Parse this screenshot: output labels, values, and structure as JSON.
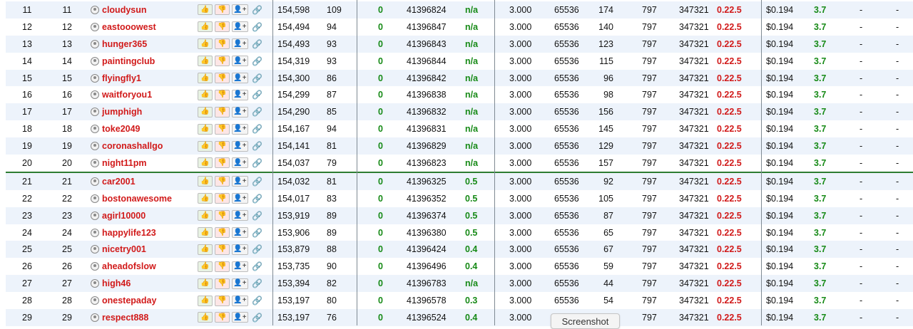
{
  "icons": {
    "upvote": "thumbs-up-icon",
    "downvote": "thumbs-down-icon",
    "follow": "add-user-icon",
    "link": "link-icon",
    "avatar": "user-avatar-icon"
  },
  "glyphs": {
    "up": "👍",
    "down": "👎",
    "add": "👤+",
    "link": "🔗"
  },
  "colors": {
    "username": "#d11a1a",
    "positive": "#178a17",
    "separator": "#2e7d32",
    "stripe": "#edf3fb"
  },
  "rows": [
    {
      "rank": "11",
      "rank2": "11",
      "user": "cloudysun",
      "score": "154,598",
      "n1": "109",
      "zero": "0",
      "id": "41396824",
      "rate": "n/a",
      "f1": "3.000",
      "f2": "65536",
      "f3": "174",
      "f4": "797",
      "f5": "347321",
      "ver": "0.22.5",
      "price": "$0.194",
      "num": "3.7",
      "d1": "-",
      "d2": "-"
    },
    {
      "rank": "12",
      "rank2": "12",
      "user": "eastooowest",
      "score": "154,494",
      "n1": "94",
      "zero": "0",
      "id": "41396847",
      "rate": "n/a",
      "f1": "3.000",
      "f2": "65536",
      "f3": "140",
      "f4": "797",
      "f5": "347321",
      "ver": "0.22.5",
      "price": "$0.194",
      "num": "3.7",
      "d1": "-",
      "d2": "-"
    },
    {
      "rank": "13",
      "rank2": "13",
      "user": "hunger365",
      "score": "154,493",
      "n1": "93",
      "zero": "0",
      "id": "41396843",
      "rate": "n/a",
      "f1": "3.000",
      "f2": "65536",
      "f3": "123",
      "f4": "797",
      "f5": "347321",
      "ver": "0.22.5",
      "price": "$0.194",
      "num": "3.7",
      "d1": "-",
      "d2": "-"
    },
    {
      "rank": "14",
      "rank2": "14",
      "user": "paintingclub",
      "score": "154,319",
      "n1": "93",
      "zero": "0",
      "id": "41396844",
      "rate": "n/a",
      "f1": "3.000",
      "f2": "65536",
      "f3": "115",
      "f4": "797",
      "f5": "347321",
      "ver": "0.22.5",
      "price": "$0.194",
      "num": "3.7",
      "d1": "-",
      "d2": "-"
    },
    {
      "rank": "15",
      "rank2": "15",
      "user": "flyingfly1",
      "score": "154,300",
      "n1": "86",
      "zero": "0",
      "id": "41396842",
      "rate": "n/a",
      "f1": "3.000",
      "f2": "65536",
      "f3": "96",
      "f4": "797",
      "f5": "347321",
      "ver": "0.22.5",
      "price": "$0.194",
      "num": "3.7",
      "d1": "-",
      "d2": "-"
    },
    {
      "rank": "16",
      "rank2": "16",
      "user": "waitforyou1",
      "score": "154,299",
      "n1": "87",
      "zero": "0",
      "id": "41396838",
      "rate": "n/a",
      "f1": "3.000",
      "f2": "65536",
      "f3": "98",
      "f4": "797",
      "f5": "347321",
      "ver": "0.22.5",
      "price": "$0.194",
      "num": "3.7",
      "d1": "-",
      "d2": "-"
    },
    {
      "rank": "17",
      "rank2": "17",
      "user": "jumphigh",
      "score": "154,290",
      "n1": "85",
      "zero": "0",
      "id": "41396832",
      "rate": "n/a",
      "f1": "3.000",
      "f2": "65536",
      "f3": "156",
      "f4": "797",
      "f5": "347321",
      "ver": "0.22.5",
      "price": "$0.194",
      "num": "3.7",
      "d1": "-",
      "d2": "-"
    },
    {
      "rank": "18",
      "rank2": "18",
      "user": "toke2049",
      "score": "154,167",
      "n1": "94",
      "zero": "0",
      "id": "41396831",
      "rate": "n/a",
      "f1": "3.000",
      "f2": "65536",
      "f3": "145",
      "f4": "797",
      "f5": "347321",
      "ver": "0.22.5",
      "price": "$0.194",
      "num": "3.7",
      "d1": "-",
      "d2": "-"
    },
    {
      "rank": "19",
      "rank2": "19",
      "user": "coronashallgo",
      "score": "154,141",
      "n1": "81",
      "zero": "0",
      "id": "41396829",
      "rate": "n/a",
      "f1": "3.000",
      "f2": "65536",
      "f3": "129",
      "f4": "797",
      "f5": "347321",
      "ver": "0.22.5",
      "price": "$0.194",
      "num": "3.7",
      "d1": "-",
      "d2": "-"
    },
    {
      "rank": "20",
      "rank2": "20",
      "user": "night11pm",
      "score": "154,037",
      "n1": "79",
      "zero": "0",
      "id": "41396823",
      "rate": "n/a",
      "f1": "3.000",
      "f2": "65536",
      "f3": "157",
      "f4": "797",
      "f5": "347321",
      "ver": "0.22.5",
      "price": "$0.194",
      "num": "3.7",
      "d1": "-",
      "d2": "-"
    },
    {
      "rank": "21",
      "rank2": "21",
      "user": "car2001",
      "score": "154,032",
      "n1": "81",
      "zero": "0",
      "id": "41396325",
      "rate": "0.5",
      "f1": "3.000",
      "f2": "65536",
      "f3": "92",
      "f4": "797",
      "f5": "347321",
      "ver": "0.22.5",
      "price": "$0.194",
      "num": "3.7",
      "d1": "-",
      "d2": "-",
      "sep": true
    },
    {
      "rank": "22",
      "rank2": "22",
      "user": "bostonawesome",
      "score": "154,017",
      "n1": "83",
      "zero": "0",
      "id": "41396352",
      "rate": "0.5",
      "f1": "3.000",
      "f2": "65536",
      "f3": "105",
      "f4": "797",
      "f5": "347321",
      "ver": "0.22.5",
      "price": "$0.194",
      "num": "3.7",
      "d1": "-",
      "d2": "-"
    },
    {
      "rank": "23",
      "rank2": "23",
      "user": "agirl10000",
      "score": "153,919",
      "n1": "89",
      "zero": "0",
      "id": "41396374",
      "rate": "0.5",
      "f1": "3.000",
      "f2": "65536",
      "f3": "87",
      "f4": "797",
      "f5": "347321",
      "ver": "0.22.5",
      "price": "$0.194",
      "num": "3.7",
      "d1": "-",
      "d2": "-"
    },
    {
      "rank": "24",
      "rank2": "24",
      "user": "happylife123",
      "score": "153,906",
      "n1": "89",
      "zero": "0",
      "id": "41396380",
      "rate": "0.5",
      "f1": "3.000",
      "f2": "65536",
      "f3": "65",
      "f4": "797",
      "f5": "347321",
      "ver": "0.22.5",
      "price": "$0.194",
      "num": "3.7",
      "d1": "-",
      "d2": "-"
    },
    {
      "rank": "25",
      "rank2": "25",
      "user": "nicetry001",
      "score": "153,879",
      "n1": "88",
      "zero": "0",
      "id": "41396424",
      "rate": "0.4",
      "f1": "3.000",
      "f2": "65536",
      "f3": "67",
      "f4": "797",
      "f5": "347321",
      "ver": "0.22.5",
      "price": "$0.194",
      "num": "3.7",
      "d1": "-",
      "d2": "-"
    },
    {
      "rank": "26",
      "rank2": "26",
      "user": "aheadofslow",
      "score": "153,735",
      "n1": "90",
      "zero": "0",
      "id": "41396496",
      "rate": "0.4",
      "f1": "3.000",
      "f2": "65536",
      "f3": "59",
      "f4": "797",
      "f5": "347321",
      "ver": "0.22.5",
      "price": "$0.194",
      "num": "3.7",
      "d1": "-",
      "d2": "-"
    },
    {
      "rank": "27",
      "rank2": "27",
      "user": "high46",
      "score": "153,394",
      "n1": "82",
      "zero": "0",
      "id": "41396783",
      "rate": "n/a",
      "f1": "3.000",
      "f2": "65536",
      "f3": "44",
      "f4": "797",
      "f5": "347321",
      "ver": "0.22.5",
      "price": "$0.194",
      "num": "3.7",
      "d1": "-",
      "d2": "-"
    },
    {
      "rank": "28",
      "rank2": "28",
      "user": "onestepaday",
      "score": "153,197",
      "n1": "80",
      "zero": "0",
      "id": "41396578",
      "rate": "0.3",
      "f1": "3.000",
      "f2": "65536",
      "f3": "54",
      "f4": "797",
      "f5": "347321",
      "ver": "0.22.5",
      "price": "$0.194",
      "num": "3.7",
      "d1": "-",
      "d2": "-"
    },
    {
      "rank": "29",
      "rank2": "29",
      "user": "respect888",
      "score": "153,197",
      "n1": "76",
      "zero": "0",
      "id": "41396524",
      "rate": "0.4",
      "f1": "3.000",
      "f2": "",
      "f3": "",
      "f4": "797",
      "f5": "347321",
      "ver": "0.22.5",
      "price": "$0.194",
      "num": "3.7",
      "d1": "-",
      "d2": "-"
    }
  ],
  "tooltip": {
    "label": "Screenshot"
  }
}
